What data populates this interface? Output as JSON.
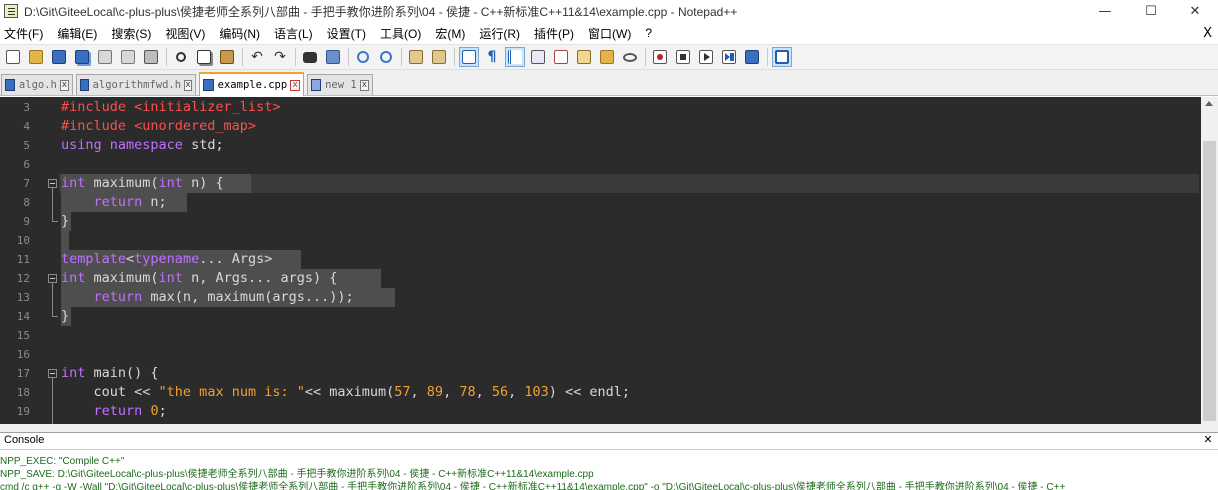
{
  "window": {
    "title": "D:\\Git\\GiteeLocal\\c-plus-plus\\侯捷老师全系列八部曲 - 手把手教你进阶系列\\04 - 侯捷 - C++新标准C++11&14\\example.cpp - Notepad++",
    "minimize": "—",
    "maximize": "☐",
    "close": "✕"
  },
  "menu": {
    "items": [
      "文件(F)",
      "编辑(E)",
      "搜索(S)",
      "视图(V)",
      "编码(N)",
      "语言(L)",
      "设置(T)",
      "工具(O)",
      "宏(M)",
      "运行(R)",
      "插件(P)",
      "窗口(W)",
      "?"
    ],
    "close": "X"
  },
  "toolbar": {
    "icons": [
      "new-file-icon",
      "open-file-icon",
      "save-icon",
      "save-all-icon",
      "close-icon",
      "close-all-icon",
      "print-icon",
      "cut-icon",
      "copy-icon",
      "paste-icon",
      "undo-icon",
      "redo-icon",
      "find-icon",
      "replace-icon",
      "zoom-in-icon",
      "zoom-out-icon",
      "sync-scroll-icon",
      "word-wrap-icon",
      "show-all-chars-icon",
      "indent-guide-icon",
      "user-language-icon",
      "document-map-icon",
      "function-list-icon",
      "folder-workspace-icon",
      "monitoring-icon",
      "record-macro-icon",
      "stop-record-icon",
      "playback-icon",
      "run-macro-multiple-icon",
      "save-macro-icon",
      "doc-switcher-icon"
    ],
    "undo_glyph": "↶",
    "redo_glyph": "↷",
    "pilcrow_glyph": "¶"
  },
  "tabs": [
    {
      "label": "algo.h",
      "close": "x",
      "active": false
    },
    {
      "label": "algorithmfwd.h",
      "close": "x",
      "active": false
    },
    {
      "label": "example.cpp",
      "close": "x",
      "active": true
    },
    {
      "label": "new 1",
      "close": "x",
      "active": false
    }
  ],
  "editor": {
    "line_numbers": [
      "3",
      "4",
      "5",
      "6",
      "7",
      "8",
      "9",
      "10",
      "11",
      "12",
      "13",
      "14",
      "15",
      "16",
      "17",
      "18",
      "19"
    ],
    "lines": [
      {
        "parts": [
          [
            "pp",
            "#include <initializer_list>"
          ]
        ]
      },
      {
        "parts": [
          [
            "pp",
            "#include <unordered_map>"
          ]
        ]
      },
      {
        "parts": [
          [
            "kw",
            "using"
          ],
          [
            "op",
            " "
          ],
          [
            "kw",
            "namespace"
          ],
          [
            "op",
            " std;"
          ]
        ]
      },
      {
        "parts": []
      },
      {
        "parts": [
          [
            "tp",
            "int"
          ],
          [
            "op",
            " maximum("
          ],
          [
            "tp",
            "int"
          ],
          [
            "op",
            " n) {"
          ]
        ]
      },
      {
        "parts": [
          [
            "op",
            "    "
          ],
          [
            "kw",
            "return"
          ],
          [
            "op",
            " n;"
          ]
        ]
      },
      {
        "parts": [
          [
            "op",
            "}"
          ]
        ]
      },
      {
        "parts": []
      },
      {
        "parts": [
          [
            "kw",
            "template"
          ],
          [
            "op",
            "<"
          ],
          [
            "kw",
            "typename"
          ],
          [
            "op",
            "... Args>"
          ]
        ]
      },
      {
        "parts": [
          [
            "tp",
            "int"
          ],
          [
            "op",
            " maximum("
          ],
          [
            "tp",
            "int"
          ],
          [
            "op",
            " n, Args... args) {"
          ]
        ]
      },
      {
        "parts": [
          [
            "op",
            "    "
          ],
          [
            "kw",
            "return"
          ],
          [
            "op",
            " max(n, maximum(args...));"
          ]
        ]
      },
      {
        "parts": [
          [
            "op",
            "}"
          ]
        ]
      },
      {
        "parts": []
      },
      {
        "parts": []
      },
      {
        "parts": [
          [
            "tp",
            "int"
          ],
          [
            "op",
            " main() {"
          ]
        ]
      },
      {
        "parts": [
          [
            "op",
            "    cout << "
          ],
          [
            "str",
            "\"the max num is: \""
          ],
          [
            "op",
            "<< maximum("
          ],
          [
            "num",
            "57"
          ],
          [
            "op",
            ", "
          ],
          [
            "num",
            "89"
          ],
          [
            "op",
            ", "
          ],
          [
            "num",
            "78"
          ],
          [
            "op",
            ", "
          ],
          [
            "num",
            "56"
          ],
          [
            "op",
            ", "
          ],
          [
            "num",
            "103"
          ],
          [
            "op",
            ") << endl;"
          ]
        ]
      },
      {
        "parts": [
          [
            "op",
            "    "
          ],
          [
            "kw",
            "return"
          ],
          [
            "op",
            " "
          ],
          [
            "num",
            "0"
          ],
          [
            "op",
            ";"
          ]
        ]
      }
    ]
  },
  "console": {
    "title": "Console",
    "close": "✕",
    "lines": [
      "NPP_EXEC: \"Compile C++\"",
      "NPP_SAVE: D:\\Git\\GiteeLocal\\c-plus-plus\\侯捷老师全系列八部曲 - 手把手教你进阶系列\\04 - 侯捷 - C++新标准C++11&14\\example.cpp",
      "cmd /c g++ -g -W -Wall \"D:\\Git\\GiteeLocal\\c-plus-plus\\侯捷老师全系列八部曲 - 手把手教你进阶系列\\04 - 侯捷 - C++新标准C++11&14\\example.cpp\" -o \"D:\\Git\\GiteeLocal\\c-plus-plus\\侯捷老师全系列八部曲 - 手把手教你进阶系列\\04 - 侯捷 - C++"
    ]
  },
  "colors": {
    "editor_bg": "#2b2b2b",
    "preprocessor": "#ff4d4d",
    "keyword": "#c06fff",
    "string_number": "#f0a030",
    "console_text": "#1e6a1e",
    "active_tab_accent": "#f2a42a"
  }
}
